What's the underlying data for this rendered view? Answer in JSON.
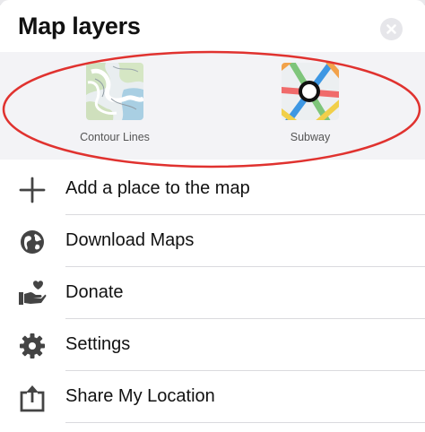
{
  "sheet": {
    "title": "Map layers",
    "close_icon": "close-icon"
  },
  "layers": [
    {
      "label": "Contour Lines",
      "icon": "contour-map-thumbnail"
    },
    {
      "label": "Subway",
      "icon": "subway-map-thumbnail"
    }
  ],
  "menu": [
    {
      "label": "Add a place to the map",
      "icon": "plus-icon"
    },
    {
      "label": "Download Maps",
      "icon": "globe-icon"
    },
    {
      "label": "Donate",
      "icon": "donate-hand-heart-icon"
    },
    {
      "label": "Settings",
      "icon": "gear-icon"
    },
    {
      "label": "Share My Location",
      "icon": "share-icon"
    }
  ],
  "colors": {
    "highlight_ellipse": "#e0322f",
    "panel_background": "#f3f3f6"
  }
}
